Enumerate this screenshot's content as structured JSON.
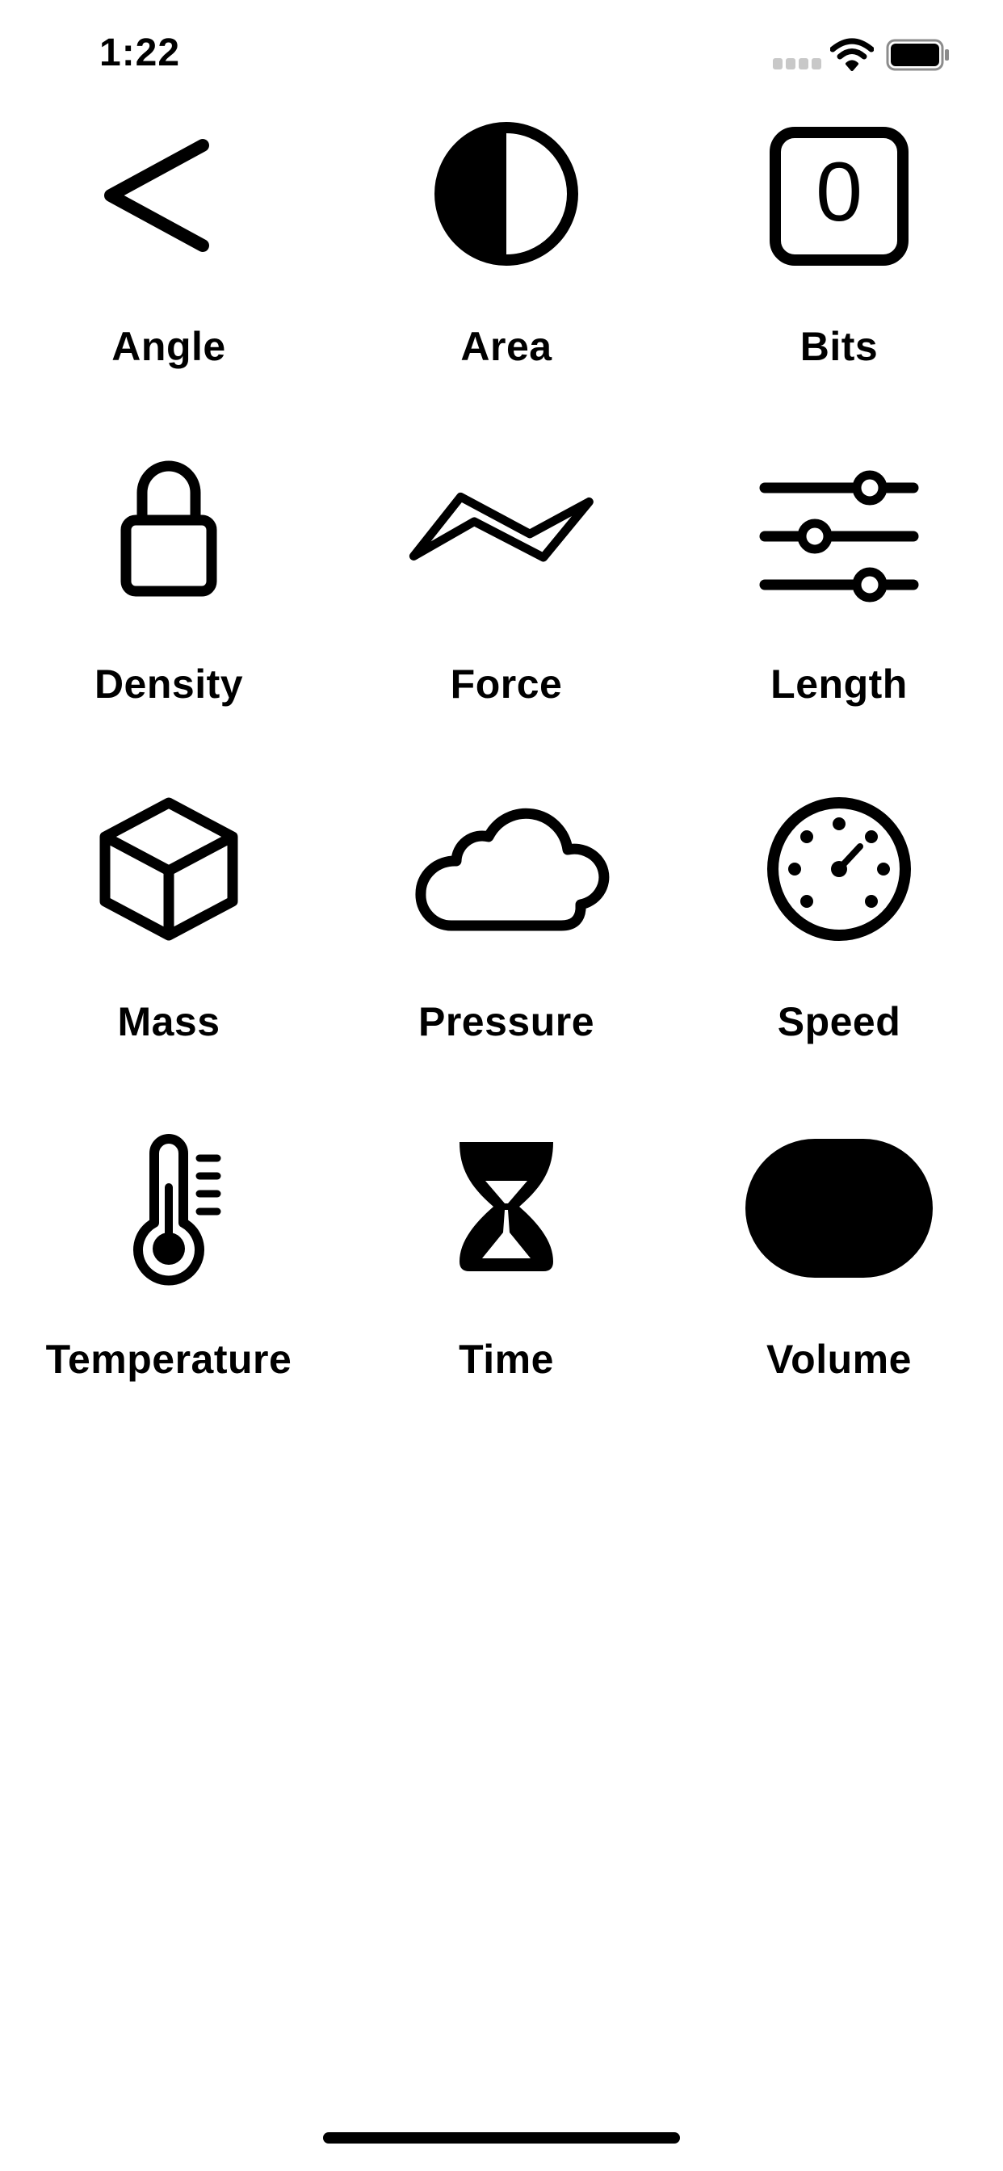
{
  "status_bar": {
    "time": "1:22"
  },
  "units": [
    {
      "label": "Angle",
      "icon": "angle-icon"
    },
    {
      "label": "Area",
      "icon": "half-circle-icon"
    },
    {
      "label": "Bits",
      "icon": "zero-square-icon"
    },
    {
      "label": "Density",
      "icon": "lock-icon"
    },
    {
      "label": "Force",
      "icon": "bolt-icon"
    },
    {
      "label": "Length",
      "icon": "sliders-icon"
    },
    {
      "label": "Mass",
      "icon": "cube-icon"
    },
    {
      "label": "Pressure",
      "icon": "cloud-icon"
    },
    {
      "label": "Speed",
      "icon": "speedometer-icon"
    },
    {
      "label": "Temperature",
      "icon": "thermometer-icon"
    },
    {
      "label": "Time",
      "icon": "hourglass-icon"
    },
    {
      "label": "Volume",
      "icon": "capsule-icon"
    }
  ],
  "bits_icon_digit": "0"
}
